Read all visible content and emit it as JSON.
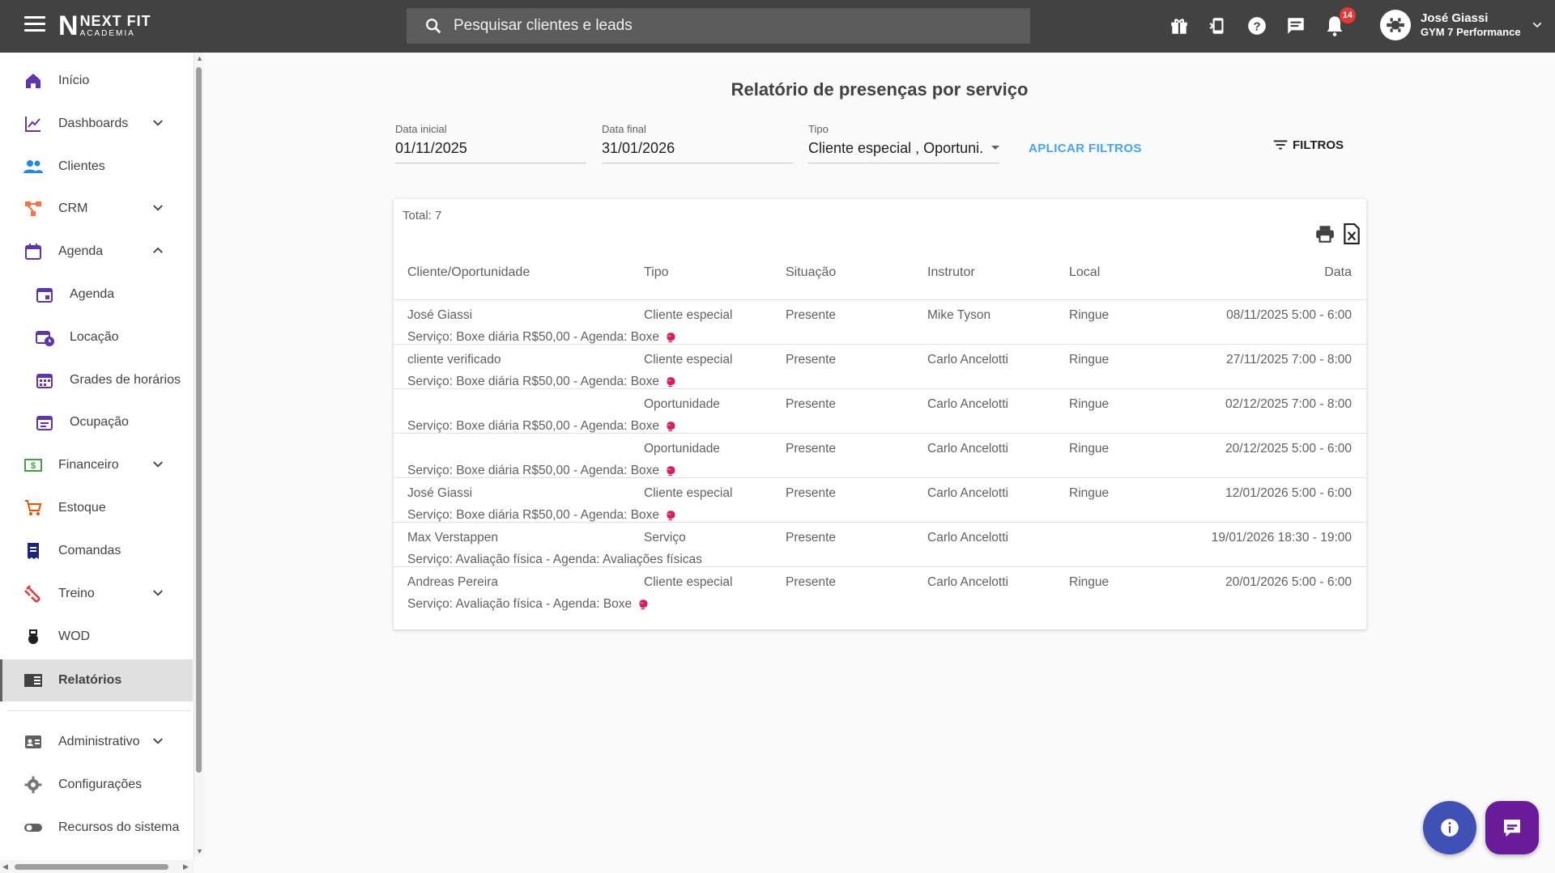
{
  "app": {
    "logo_name": "NEXT FIT",
    "logo_sub": "ACADEMIA",
    "logo_mark": "N"
  },
  "search": {
    "placeholder": "Pesquisar clientes e leads"
  },
  "topbar": {
    "icons": [
      "gift-icon",
      "phone-icon",
      "help-icon",
      "chat-icon",
      "bell-icon"
    ],
    "notifications_count": "14"
  },
  "user": {
    "name": "José Giassi",
    "org": "GYM 7 Performance"
  },
  "sidebar": {
    "items": [
      {
        "label": "Início",
        "icon": "home-icon"
      },
      {
        "label": "Dashboards",
        "icon": "chart-icon"
      },
      {
        "label": "Clientes",
        "icon": "people-icon"
      },
      {
        "label": "CRM",
        "icon": "crm-icon"
      },
      {
        "label": "Agenda",
        "icon": "calendar-icon"
      },
      {
        "label": "Agenda",
        "icon": "calendar-event-icon"
      },
      {
        "label": "Locação",
        "icon": "calendar-clock-icon"
      },
      {
        "label": "Grades de horários",
        "icon": "calendar-grid-icon"
      },
      {
        "label": "Ocupação",
        "icon": "calendar-list-icon"
      },
      {
        "label": "Financeiro",
        "icon": "money-icon"
      },
      {
        "label": "Estoque",
        "icon": "cart-icon"
      },
      {
        "label": "Comandas",
        "icon": "receipt-icon"
      },
      {
        "label": "Treino",
        "icon": "dumbbell-icon"
      },
      {
        "label": "WOD",
        "icon": "kettlebell-icon"
      },
      {
        "label": "Relatórios",
        "icon": "reports-icon"
      },
      {
        "label": "Administrativo",
        "icon": "id-card-icon"
      },
      {
        "label": "Configurações",
        "icon": "gear-icon"
      },
      {
        "label": "Recursos do sistema",
        "icon": "toggle-icon"
      }
    ]
  },
  "report": {
    "title": "Relatório de presenças por serviço",
    "filters": {
      "start_label": "Data inicial",
      "start_value": "01/11/2025",
      "end_label": "Data final",
      "end_value": "31/01/2026",
      "type_label": "Tipo",
      "type_value": "Cliente especial , Oportuni...",
      "apply_label": "APLICAR FILTROS",
      "filters_label": "FILTROS"
    },
    "total_label": "Total: 7",
    "columns": [
      "Cliente/Oportunidade",
      "Tipo",
      "Situação",
      "Instrutor",
      "Local",
      "Data"
    ],
    "rows": [
      {
        "cliente": "José Giassi",
        "tipo": "Cliente especial",
        "situacao": "Presente",
        "instrutor": "Mike Tyson",
        "local": "Ringue",
        "data": "08/11/2025 5:00 - 6:00",
        "descricao": "Serviço: Boxe diária R$50,00 - Agenda: Boxe",
        "glove": true
      },
      {
        "cliente": "cliente verificado",
        "tipo": "Cliente especial",
        "situacao": "Presente",
        "instrutor": "Carlo Ancelotti",
        "local": "Ringue",
        "data": "27/11/2025 7:00 - 8:00",
        "descricao": "Serviço: Boxe diária R$50,00 - Agenda: Boxe",
        "glove": true
      },
      {
        "cliente": "",
        "tipo": "Oportunidade",
        "situacao": "Presente",
        "instrutor": "Carlo Ancelotti",
        "local": "Ringue",
        "data": "02/12/2025 7:00 - 8:00",
        "descricao": "Serviço: Boxe diária R$50,00 - Agenda: Boxe",
        "glove": true
      },
      {
        "cliente": "",
        "tipo": "Oportunidade",
        "situacao": "Presente",
        "instrutor": "Carlo Ancelotti",
        "local": "Ringue",
        "data": "20/12/2025 5:00 - 6:00",
        "descricao": "Serviço: Boxe diária R$50,00 - Agenda: Boxe",
        "glove": true
      },
      {
        "cliente": "José Giassi",
        "tipo": "Cliente especial",
        "situacao": "Presente",
        "instrutor": "Carlo Ancelotti",
        "local": "Ringue",
        "data": "12/01/2026 5:00 - 6:00",
        "descricao": "Serviço: Boxe diária R$50,00 - Agenda: Boxe",
        "glove": true
      },
      {
        "cliente": "Max Verstappen",
        "tipo": "Serviço",
        "situacao": "Presente",
        "instrutor": "Carlo Ancelotti",
        "local": "",
        "data": "19/01/2026 18:30 - 19:00",
        "descricao": "Serviço: Avaliação física - Agenda: Avaliações físicas",
        "glove": false
      },
      {
        "cliente": "Andreas Pereira",
        "tipo": "Cliente especial",
        "situacao": "Presente",
        "instrutor": "Carlo Ancelotti",
        "local": "Ringue",
        "data": "20/01/2026 5:00 - 6:00",
        "descricao": "Serviço: Avaliação física - Agenda: Boxe",
        "glove": true
      }
    ]
  },
  "colors": {
    "topbar": "#424242",
    "primary_purple": "#5e35b1",
    "apply_blue": "#42a5f5",
    "fab_info": "#3f51b5",
    "fab_chat": "#6a1b9a",
    "badge_red": "#e53935"
  }
}
